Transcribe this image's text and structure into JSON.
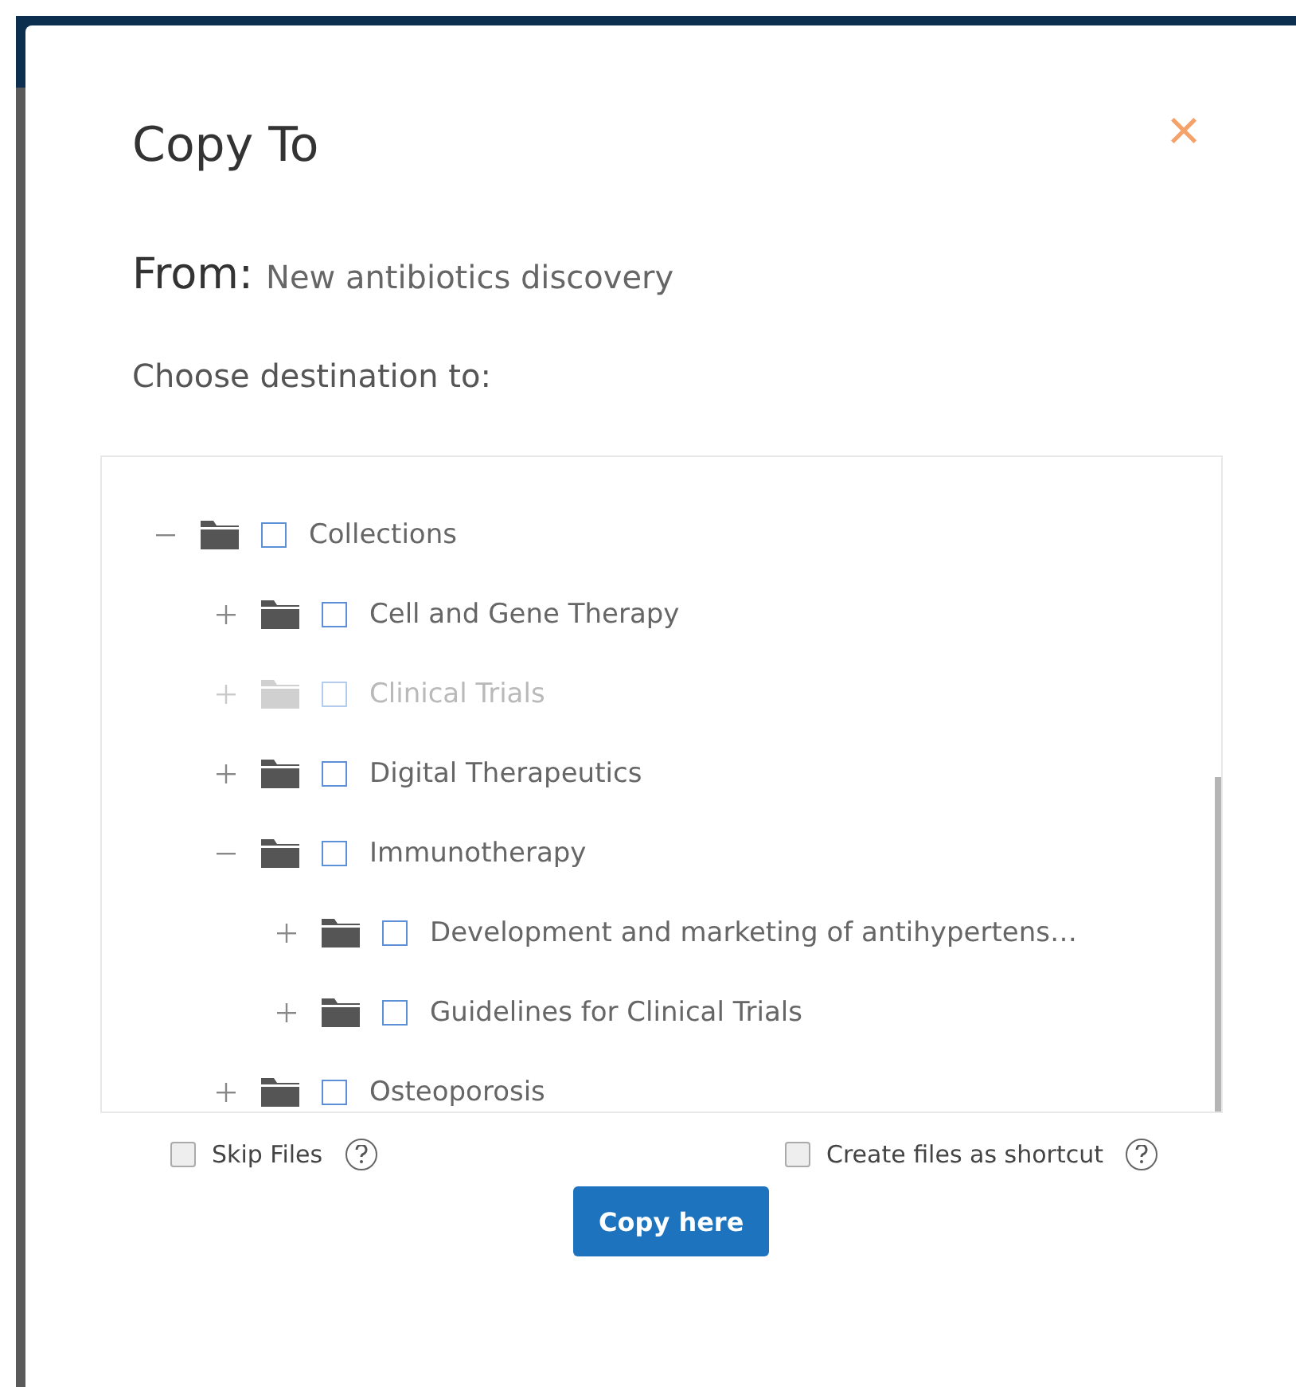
{
  "dialog": {
    "title": "Copy To",
    "close": "×",
    "from_label": "From:",
    "from_value": "New antibiotics discovery",
    "prompt": "Choose destination to:",
    "tree": [
      {
        "label": "Collections",
        "expanded": true,
        "checked": false,
        "disabled": false,
        "children": [
          {
            "label": "Cell and Gene Therapy",
            "expanded": false,
            "checked": false,
            "disabled": false
          },
          {
            "label": "Clinical Trials",
            "expanded": false,
            "checked": false,
            "disabled": true
          },
          {
            "label": "Digital Therapeutics",
            "expanded": false,
            "checked": false,
            "disabled": false
          },
          {
            "label": "Immunotherapy",
            "expanded": true,
            "checked": false,
            "disabled": false,
            "children": [
              {
                "label": "Development and marketing of antihypertens…",
                "expanded": false,
                "checked": false,
                "disabled": false
              },
              {
                "label": "Guidelines for Clinical Trials",
                "expanded": false,
                "checked": false,
                "disabled": false
              }
            ]
          },
          {
            "label": "Osteoporosis",
            "expanded": false,
            "checked": false,
            "disabled": false
          }
        ]
      }
    ],
    "options": [
      {
        "label": "Skip Files",
        "checked": false
      },
      {
        "label": "Create files as shortcut",
        "checked": false
      }
    ],
    "button": "Copy here"
  }
}
